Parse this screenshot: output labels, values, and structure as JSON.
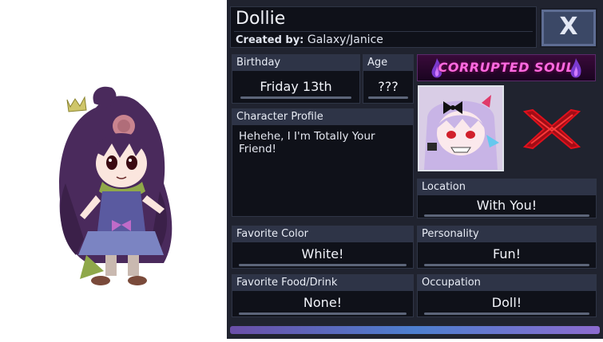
{
  "character": {
    "name": "Dollie",
    "created_by_label": "Created by:",
    "created_by_value": "Galaxy/Janice"
  },
  "close_button": {
    "label": "X"
  },
  "fields": {
    "birthday": {
      "label": "Birthday",
      "value": "Friday 13th"
    },
    "age": {
      "label": "Age",
      "value": "???"
    },
    "profile": {
      "label": "Character Profile",
      "value": "Hehehe, I I'm Totally Your Friend!"
    },
    "location": {
      "label": "Location",
      "value": "With You!"
    },
    "favorite_color": {
      "label": "Favorite Color",
      "value": "White!"
    },
    "personality": {
      "label": "Personality",
      "value": "Fun!"
    },
    "favorite_food": {
      "label": "Favorite Food/Drink",
      "value": "None!"
    },
    "occupation": {
      "label": "Occupation",
      "value": "Doll!"
    }
  },
  "banner": {
    "text": "CORRUPTED SOUL"
  },
  "colors": {
    "panel_bg": "#20232f",
    "box_bg": "#0f1119",
    "header_bg": "#2e3447",
    "accent_pink": "#ff6ae0",
    "accent_red": "#e0101c"
  }
}
